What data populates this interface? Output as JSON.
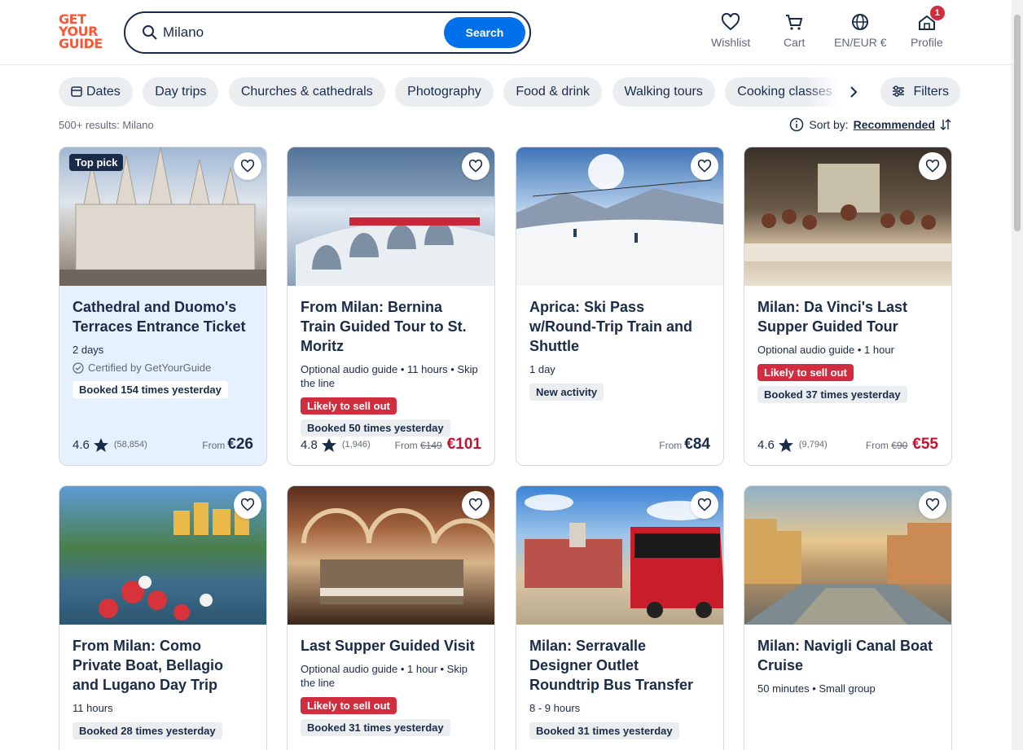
{
  "brand": {
    "logo_lines": [
      "GET",
      "YOUR",
      "GUIDE"
    ],
    "accent": "#ff5533",
    "primary": "#0071eb"
  },
  "search": {
    "value": "Milano",
    "button": "Search"
  },
  "nav": {
    "wishlist": "Wishlist",
    "cart": "Cart",
    "locale": "EN/EUR €",
    "profile": "Profile",
    "profile_badge": "1"
  },
  "chips": [
    "Dates",
    "Day trips",
    "Churches & cathedrals",
    "Photography",
    "Food & drink",
    "Walking tours",
    "Cooking classes"
  ],
  "filters_label": "Filters",
  "results_text": "500+ results: Milano",
  "sort": {
    "label": "Sort by:",
    "value": "Recommended"
  },
  "cards": [
    {
      "title": "Cathedral and Duomo's Terraces Entrance Ticket",
      "meta": "2 days",
      "top_pick": "Top pick",
      "certified": "Certified by GetYourGuide",
      "booked": "Booked 154 times yesterday",
      "rating": "4.6",
      "reviews": "(58,854)",
      "price_from": "From",
      "price": "€26",
      "highlight": true
    },
    {
      "title": "From Milan: Bernina Train Guided Tour to St. Moritz",
      "meta": "Optional audio guide • 11 hours • Skip the line",
      "sell_out": "Likely to sell out",
      "booked": "Booked 50 times yesterday",
      "rating": "4.8",
      "reviews": "(1,946)",
      "price_from": "From",
      "old_price": "€149",
      "price": "€101"
    },
    {
      "title": "Aprica: Ski Pass w/Round-Trip Train and Shuttle",
      "meta": "1 day",
      "new_tag": "New activity",
      "price_from": "From",
      "price": "€84"
    },
    {
      "title": "Milan: Da Vinci's Last Supper Guided Tour",
      "meta": "Optional audio guide • 1 hour",
      "sell_out": "Likely to sell out",
      "booked": "Booked 37 times yesterday",
      "rating": "4.6",
      "reviews": "(9,794)",
      "price_from": "From",
      "old_price": "€90",
      "price": "€55"
    },
    {
      "title": "From Milan: Como Private Boat, Bellagio and Lugano Day Trip",
      "meta": "11 hours",
      "booked": "Booked 28 times yesterday"
    },
    {
      "title": "Last Supper Guided Visit",
      "meta": "Optional audio guide • 1 hour • Skip the line",
      "sell_out": "Likely to sell out",
      "booked": "Booked 31 times yesterday"
    },
    {
      "title": "Milan: Serravalle Designer Outlet Roundtrip Bus Transfer",
      "meta": "8 - 9 hours",
      "booked": "Booked 31 times yesterday"
    },
    {
      "title": "Milan: Navigli Canal Boat Cruise",
      "meta": "50 minutes • Small group"
    }
  ]
}
